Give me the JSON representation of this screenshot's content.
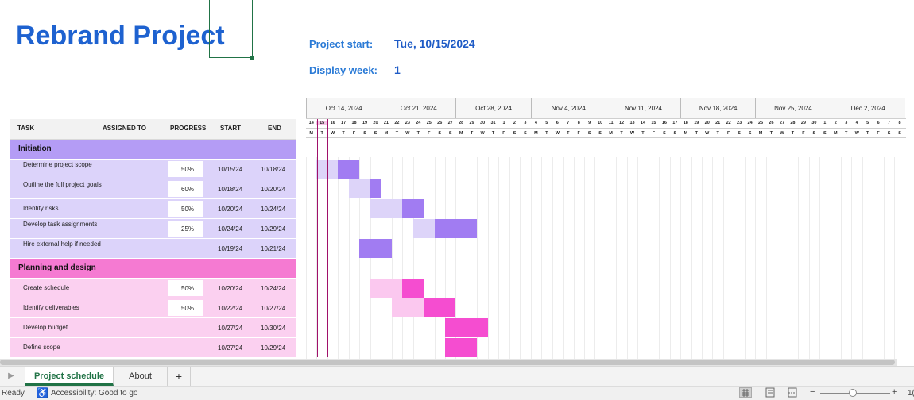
{
  "header": {
    "title": "Rebrand Project",
    "project_start_label": "Project start:",
    "project_start_value": "Tue, 10/15/2024",
    "display_week_label": "Display week:",
    "display_week_value": "1"
  },
  "table": {
    "columns": [
      "TASK",
      "ASSIGNED TO",
      "PROGRESS",
      "START",
      "END"
    ],
    "phases": [
      {
        "name": "Initiation",
        "header_color": "#b49cf5",
        "row_color": "#dcd3fa",
        "bar_dark": "#a17cf2",
        "bar_light": "#ddd4f9",
        "tasks": [
          {
            "name": "Determine project scope",
            "progress": "50%",
            "progress_value": 0.5,
            "start": "10/15/24",
            "end": "10/18/24"
          },
          {
            "name": "Outline the full project goals",
            "progress": "60%",
            "progress_value": 0.6,
            "start": "10/18/24",
            "end": "10/20/24"
          },
          {
            "name": "Identify risks",
            "progress": "50%",
            "progress_value": 0.5,
            "start": "10/20/24",
            "end": "10/24/24"
          },
          {
            "name": "Develop task assignments",
            "progress": "25%",
            "progress_value": 0.25,
            "start": "10/24/24",
            "end": "10/29/24"
          },
          {
            "name": "Hire external help if needed",
            "progress": "",
            "progress_value": null,
            "start": "10/19/24",
            "end": "10/21/24"
          }
        ]
      },
      {
        "name": "Planning and design",
        "header_color": "#f57ad2",
        "row_color": "#fbd0f0",
        "bar_dark": "#f54dd0",
        "bar_light": "#fbc8ef",
        "tasks": [
          {
            "name": "Create schedule",
            "progress": "50%",
            "progress_value": 0.5,
            "start": "10/20/24",
            "end": "10/24/24"
          },
          {
            "name": "Identify deliverables",
            "progress": "50%",
            "progress_value": 0.5,
            "start": "10/22/24",
            "end": "10/27/24"
          },
          {
            "name": "Develop budget",
            "progress": "",
            "progress_value": null,
            "start": "10/27/24",
            "end": "10/30/24"
          },
          {
            "name": "Define scope",
            "progress": "",
            "progress_value": null,
            "start": "10/27/24",
            "end": "10/29/24"
          }
        ]
      }
    ]
  },
  "gantt": {
    "weeks": [
      "Oct 14, 2024",
      "Oct 21, 2024",
      "Oct 28, 2024",
      "Nov 4, 2024",
      "Nov 11, 2024",
      "Nov 18, 2024",
      "Nov 25, 2024",
      "Dec 2, 2024"
    ],
    "day_numbers": [
      "14",
      "15",
      "16",
      "17",
      "18",
      "19",
      "20",
      "21",
      "22",
      "23",
      "24",
      "25",
      "26",
      "27",
      "28",
      "29",
      "30",
      "31",
      "1",
      "2",
      "3",
      "4",
      "5",
      "6",
      "7",
      "8",
      "9",
      "10",
      "11",
      "12",
      "13",
      "14",
      "15",
      "16",
      "17",
      "18",
      "19",
      "20",
      "21",
      "22",
      "23",
      "24",
      "25",
      "26",
      "27",
      "28",
      "29",
      "30",
      "1",
      "2",
      "3",
      "4",
      "5",
      "6",
      "7",
      "8"
    ],
    "day_letters": [
      "M",
      "T",
      "W",
      "T",
      "F",
      "S",
      "S"
    ]
  },
  "sheet_tabs": {
    "prev_icon": "play-left-icon",
    "tabs": [
      "Project schedule",
      "About"
    ],
    "active": "Project schedule",
    "add_label": "+"
  },
  "status_bar": {
    "ready": "Ready",
    "accessibility": "Accessibility: Good to go",
    "zoom_minus": "−",
    "zoom_plus": "+",
    "zoom_value": "1("
  },
  "colors": {
    "title_blue": "#1e62d0",
    "excel_green": "#217346",
    "today_line": "#a0106a"
  }
}
